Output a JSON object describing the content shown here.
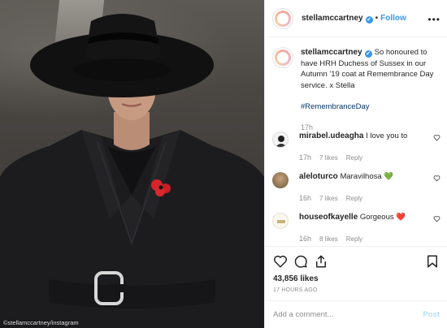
{
  "photo": {
    "credit": "©stellamccartney/instagram",
    "alt_icons": [
      "hat",
      "poppy",
      "belt-buckle"
    ]
  },
  "header": {
    "username": "stellamccartney",
    "verified_glyph": "✔",
    "separator": "•",
    "follow_label": "Follow",
    "more_glyph": "•••"
  },
  "caption": {
    "username": "stellamccartney",
    "text": "So honoured to have HRH Duchess of Sussex in our Autumn '19 coat at Remembrance Day service. x Stella",
    "hashtag": "#RemembranceDay",
    "time": "17h"
  },
  "comments": [
    {
      "username": "mirabel.udeagha",
      "text": "I love you to",
      "emoji": "",
      "time": "17h",
      "likes": "7 likes",
      "reply": "Reply"
    },
    {
      "username": "aleloturco",
      "text": "Maravilhosa",
      "emoji": "💚",
      "time": "16h",
      "likes": "7 likes",
      "reply": "Reply"
    },
    {
      "username": "houseofkayelle",
      "text": "Gorgeous",
      "emoji": "❤️",
      "time": "16h",
      "likes": "8 likes",
      "reply": "Reply"
    }
  ],
  "actions": {
    "likes": "43,856 likes",
    "ago": "17 HOURS AGO",
    "comment_placeholder": "Add a comment...",
    "post_label": "Post"
  },
  "colors": {
    "accent": "#3897f0",
    "hashtag": "#003569",
    "muted": "#8e8e8e",
    "post_disabled": "#b2dffc",
    "poppy": "#d4252a"
  }
}
